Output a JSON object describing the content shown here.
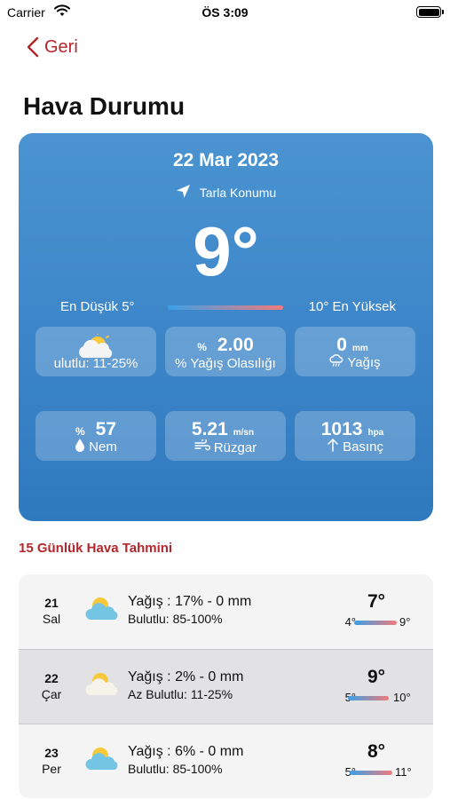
{
  "status_bar": {
    "carrier": "Carrier",
    "time": "ÖS 3:09"
  },
  "nav": {
    "back_label": "Geri"
  },
  "title": "Hava Durumu",
  "today": {
    "date": "22 Mar 2023",
    "location": "Tarla Konumu",
    "temp": "9°",
    "low": "En Düşük 5°",
    "high": "10° En Yüksek",
    "tiles": {
      "cloud": {
        "label": "ulutlu: 11-25%"
      },
      "rain_prob": {
        "prefix": "%",
        "value": "2.00",
        "label": "% Yağış Olasılığı"
      },
      "rain": {
        "value": "0",
        "unit": "mm",
        "label": "Yağış"
      },
      "humidity": {
        "prefix": "%",
        "value": "57",
        "label": "Nem"
      },
      "wind": {
        "value": "5.21",
        "unit": "m/sn",
        "label": "Rüzgar"
      },
      "pressure": {
        "value": "1013",
        "unit": "hpa",
        "label": "Basınç"
      }
    }
  },
  "forecast_title": "15  Günlük Hava Tahmini",
  "forecast": [
    {
      "day": "21",
      "weekday": "Sal",
      "rain": "Yağış : 17% - 0 mm",
      "cloud": "Bulutlu: 85-100%",
      "temp": "7°",
      "min": "4°",
      "max": "9°"
    },
    {
      "day": "22",
      "weekday": "Çar",
      "rain": "Yağış : 2% - 0 mm",
      "cloud": "Az Bulutlu: 11-25%",
      "temp": "9°",
      "min": "5°",
      "max": "10°"
    },
    {
      "day": "23",
      "weekday": "Per",
      "rain": "Yağış : 6% - 0 mm",
      "cloud": "Bulutlu: 85-100%",
      "temp": "8°",
      "min": "5°",
      "max": "11°"
    }
  ],
  "colors": {
    "accent": "#b3262b",
    "card": "#3d86c9",
    "range_start": "#3aa0e8",
    "range_end": "#f07b7b"
  }
}
